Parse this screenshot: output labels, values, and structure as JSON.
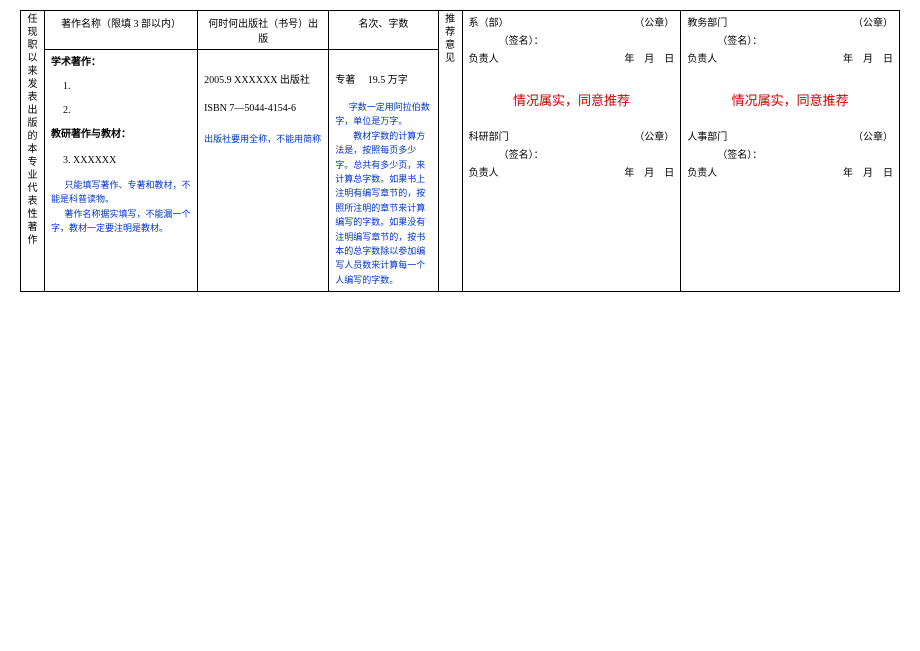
{
  "headers": {
    "side_left": "任现职以来发表出版的本专业代表性著作",
    "col_title": "著作名称（限填 3 部以内）",
    "col_pub": "何时何出版社（书号）出版",
    "col_count": "名次、字数",
    "side_opinion": "推荐意见"
  },
  "works": {
    "academic_label": "学术著作：",
    "item1": "1.",
    "item2": "2.",
    "textbook_label": "教研著作与教材：",
    "item3": "3.  XXXXXX",
    "note1": "只能填写著作、专著和教材，不能是科普读物。",
    "note2": "著作名称据实填写，不能漏一个字，教材一定要注明是教材。"
  },
  "pub": {
    "line1": "2005.9 XXXXXX 出版社",
    "line2": "ISBN 7—5044-4154-6",
    "note": "出版社要用全称，不能用简称"
  },
  "count": {
    "line1": "专著　 19.5 万字",
    "note": "字数一定用阿拉伯数字，单位是万字。\n　　教材字数的计算方法是，按照每页多少字。总共有多少页，来计算总字数。如果书上注明有编写章节的，按照所注明的章节来计算编写的字数。如果没有注明编写章节的，按书本的总字数除以参加编写人员数来计算每一个人编写的字数。"
  },
  "approval": {
    "dept1_label": "系（部）",
    "dept1_sig_label": "（签名）：",
    "dept1_seal": "（公章）",
    "person_label": "负责人",
    "date_label": "年　月　日",
    "approve_text": "情况属实，同意推荐",
    "dept2_label": "科研部门",
    "dept2_sig_label": "（签名）：",
    "dept3_label": "教务部门",
    "dept3_sig_label": "（签名）：",
    "dept4_label": "人事部门",
    "dept4_sig_label": "（签名）："
  }
}
